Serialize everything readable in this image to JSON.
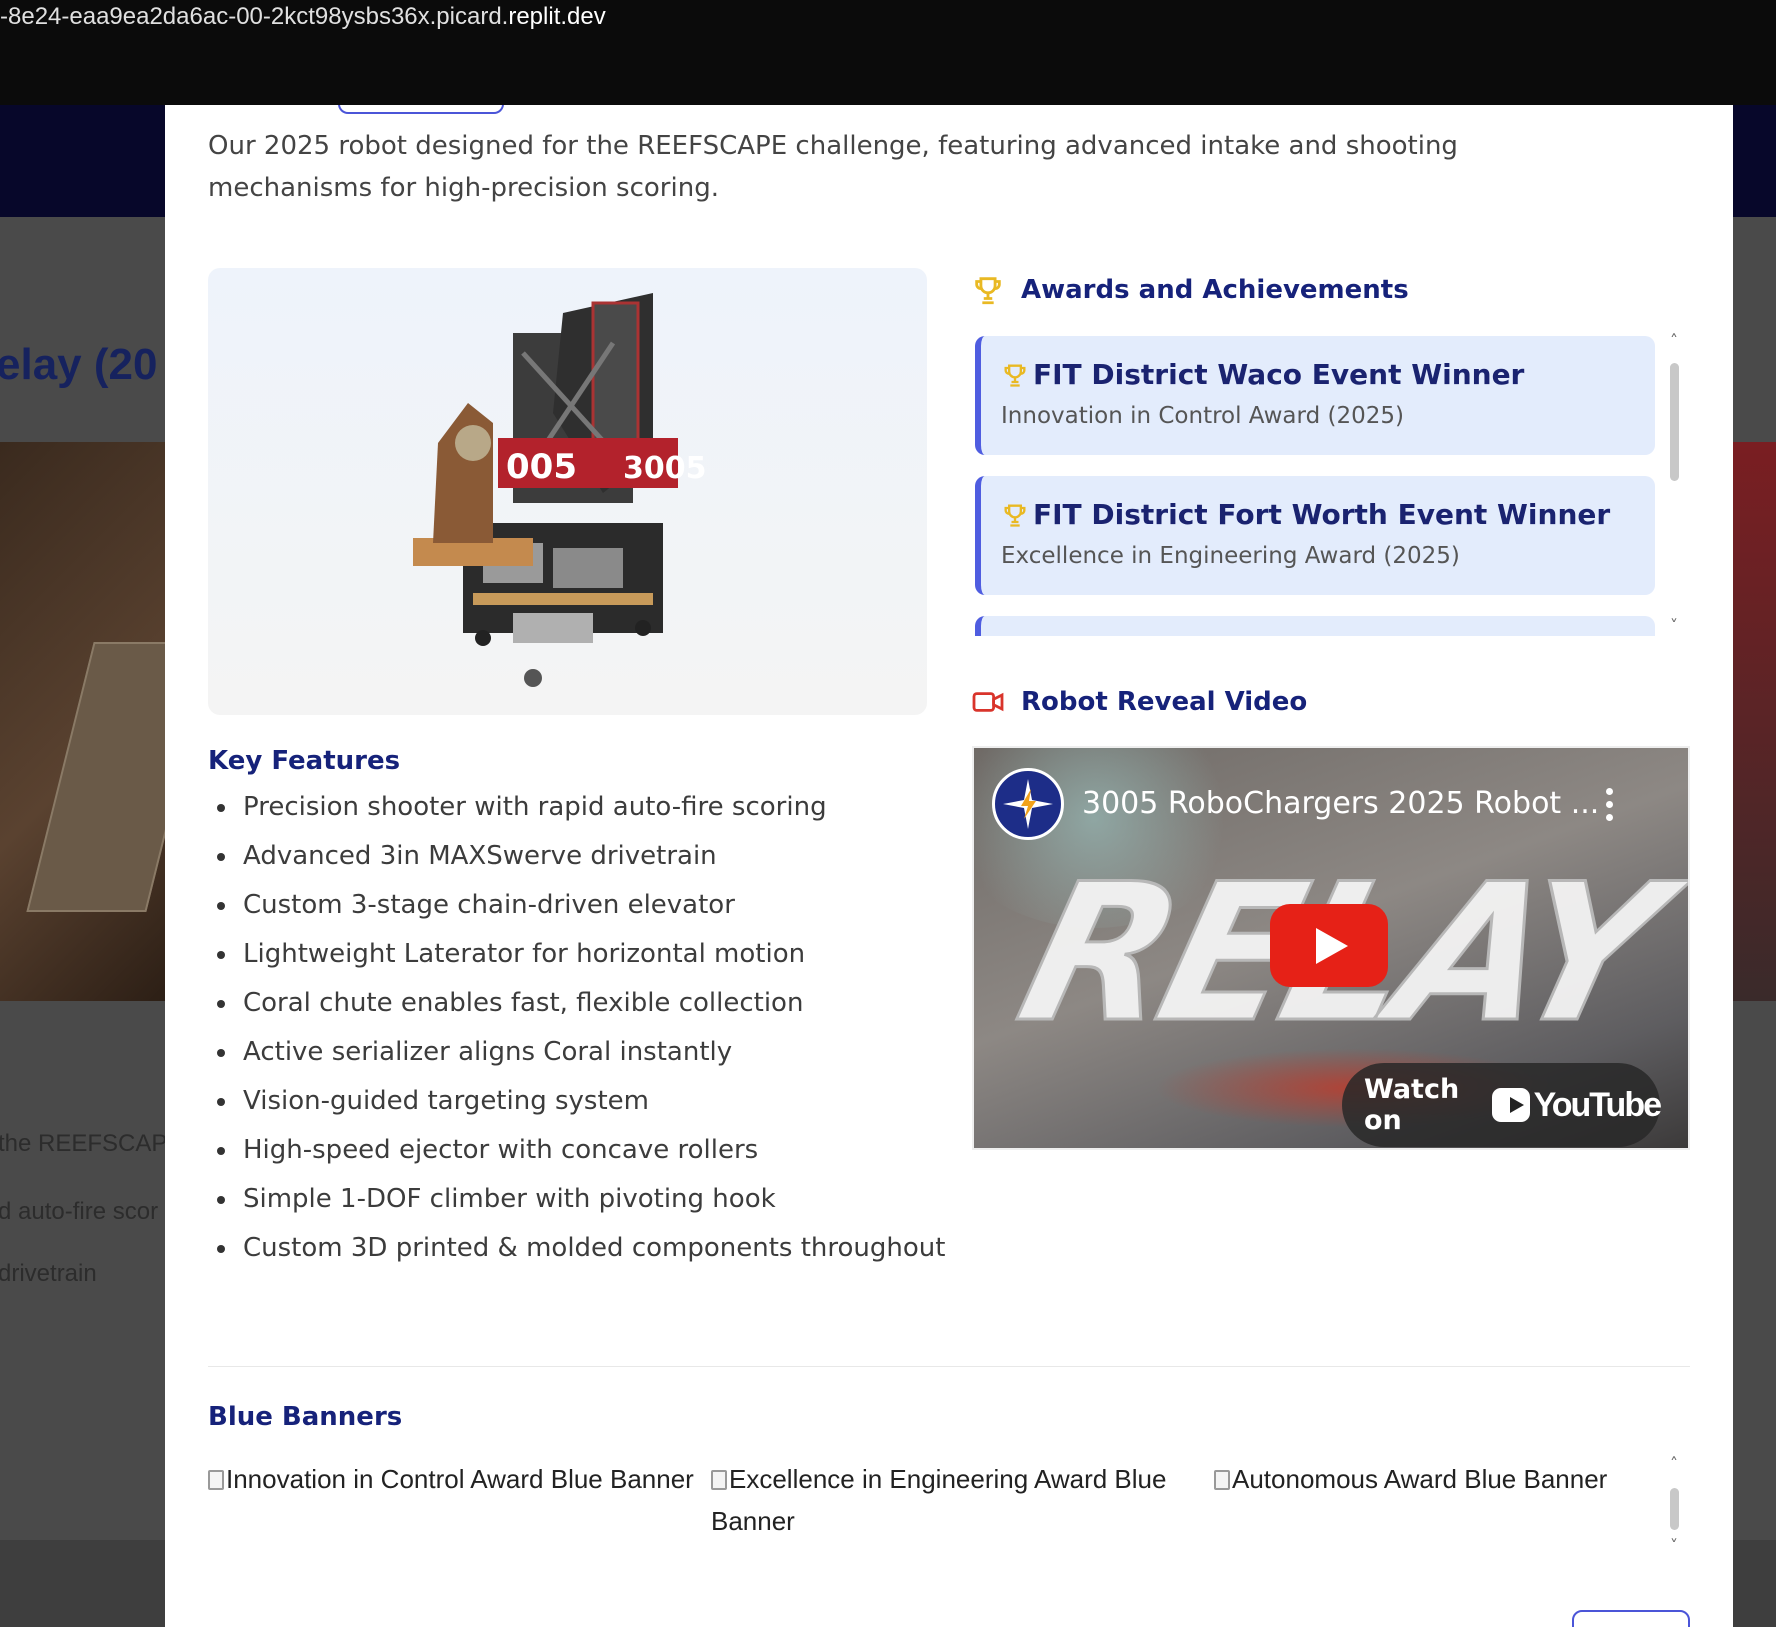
{
  "browser": {
    "url_prefix": "-8e24-eaa9ea2da6ac-00-2kct98ysbs36x.picard.",
    "url_domain": "replit.dev"
  },
  "background_page": {
    "title": "elay (20",
    "lines": [
      "the REEFSCAPE",
      "d auto-fire scor",
      "drivetrain"
    ]
  },
  "modal": {
    "description": "Our 2025 robot designed for the REEFSCAPE challenge, featuring advanced intake and shooting mechanisms for high-precision scoring.",
    "robot_image_icon": "robot-photo",
    "key_features": {
      "heading": "Key Features",
      "items": [
        "Precision shooter with rapid auto-fire scoring",
        "Advanced 3in MAXSwerve drivetrain",
        "Custom 3-stage chain-driven elevator",
        "Lightweight Laterator for horizontal motion",
        "Coral chute enables fast, flexible collection",
        "Active serializer aligns Coral instantly",
        "Vision-guided targeting system",
        "High-speed ejector with concave rollers",
        "Simple 1-DOF climber with pivoting hook",
        "Custom 3D printed & molded components throughout"
      ]
    },
    "awards": {
      "heading": "Awards and Achievements",
      "icon": "trophy-icon",
      "items": [
        {
          "title": "FIT District Waco Event Winner",
          "subtitle": "Innovation in Control Award (2025)"
        },
        {
          "title": "FIT District Fort Worth Event Winner",
          "subtitle": "Excellence in Engineering Award (2025)"
        }
      ]
    },
    "video": {
      "heading": "Robot Reveal Video",
      "icon": "video-camera-icon",
      "title": "3005 RoboChargers 2025 Robot ...",
      "watch_on": "Watch on",
      "platform": "YouTube",
      "thumbnail_text": "RELAY"
    },
    "blue_banners": {
      "heading": "Blue Banners",
      "items": [
        "Innovation in Control Award Blue Banner",
        "Excellence in Engineering Award Blue Banner",
        "Autonomous Award Blue Banner"
      ]
    },
    "colors": {
      "accent": "#4f5de0",
      "heading": "#16227a",
      "award_bg": "#e3ecfc",
      "trophy": "#e9b923",
      "video_icon": "#d9342b"
    }
  }
}
